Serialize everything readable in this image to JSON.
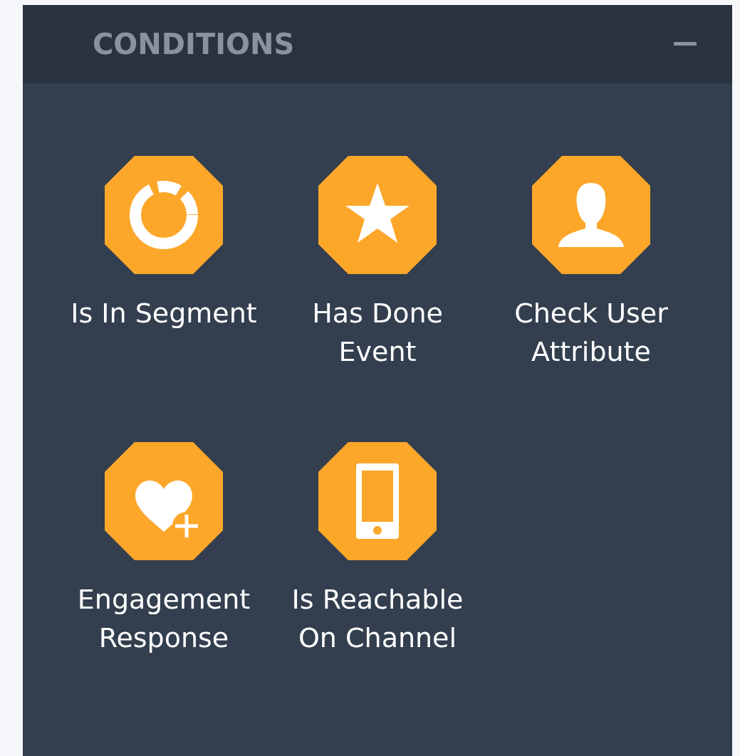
{
  "panel": {
    "title": "CONDITIONS",
    "expanded": true,
    "items": [
      {
        "kind": "segment",
        "label": "Is In Segment"
      },
      {
        "kind": "event",
        "label": "Has Done Event"
      },
      {
        "kind": "user",
        "label": "Check User Attribute"
      },
      {
        "kind": "engagement",
        "label": "Engagement Response"
      },
      {
        "kind": "device",
        "label": "Is Reachable On Channel"
      }
    ]
  }
}
